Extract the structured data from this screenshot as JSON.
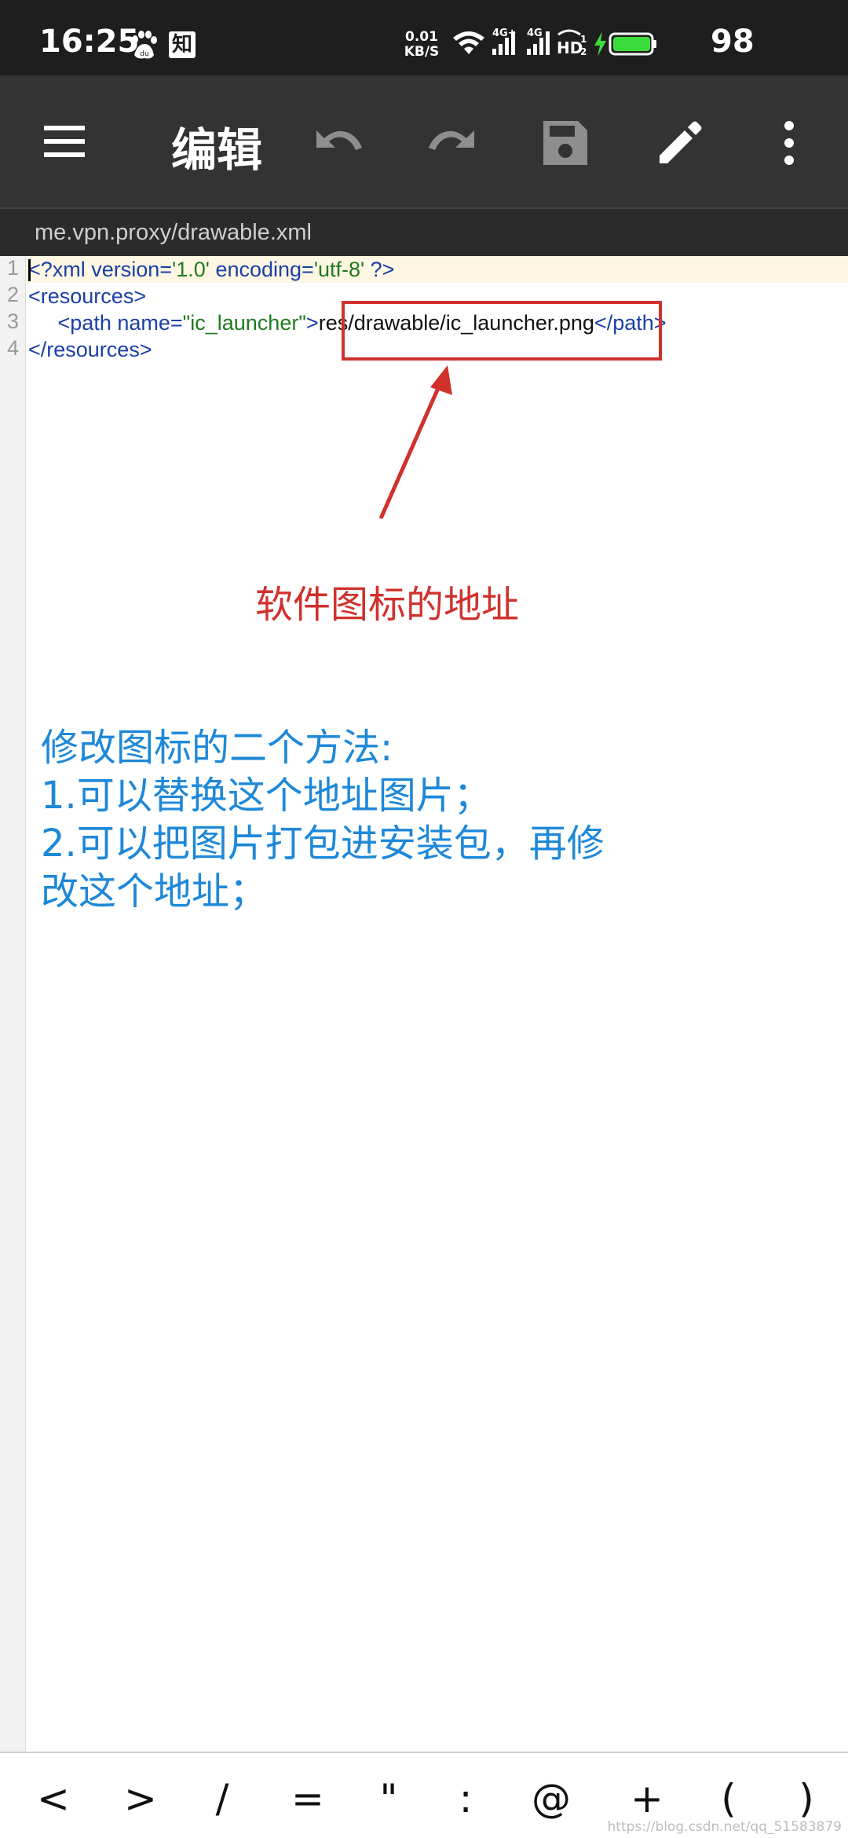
{
  "status_bar": {
    "time": "16:25",
    "net_speed_value": "0.01",
    "net_speed_unit": "KB/S",
    "signal1_label": "4G+",
    "signal2_label": "4G",
    "hd_label": "HD",
    "hd_sub": "1",
    "hd_sub2": "2",
    "battery_level": "98",
    "zhi_label": "知",
    "paw_label": "du"
  },
  "toolbar": {
    "title": "编辑",
    "icons": [
      "menu-icon",
      "undo-icon",
      "redo-icon",
      "save-icon",
      "pencil-icon",
      "more-vert-icon"
    ]
  },
  "path_bar": {
    "file_path": "me.vpn.proxy/drawable.xml"
  },
  "editor": {
    "line_numbers": [
      "1",
      "2",
      "3",
      "4"
    ],
    "line1": {
      "open": "<?xml ",
      "attr1": "version=",
      "val1": "'1.0'",
      "attr2": " encoding=",
      "val2": "'utf-8'",
      "close": " ?>"
    },
    "line2": {
      "text": "<resources>"
    },
    "line3": {
      "indent": "     ",
      "open": "<path ",
      "attr": "name=",
      "val": "\"ic_launcher\"",
      "gt": ">",
      "content": "res/drawable/ic_launcher.png",
      "close": "</path>"
    },
    "line4": {
      "text": "</resources>"
    }
  },
  "annotations": {
    "label": "软件图标的地址",
    "note_lines": [
      "修改图标的二个方法:",
      "1.可以替换这个地址图片；",
      "2.可以把图片打包进安装包，再修",
      "改这个地址；"
    ],
    "color": "#d0312d",
    "note_color": "#1e88d8"
  },
  "symbol_bar": {
    "keys": [
      "<",
      ">",
      "/",
      "=",
      "\"",
      ":",
      "@",
      "+",
      "(",
      ")"
    ]
  },
  "watermark": "https://blog.csdn.net/qq_51583879",
  "colors": {
    "status_bg": "#1e1e1e",
    "toolbar_bg": "#333333",
    "battery": "#3ddc3d",
    "tag": "#1b3fa6",
    "value": "#1f7a1f"
  }
}
